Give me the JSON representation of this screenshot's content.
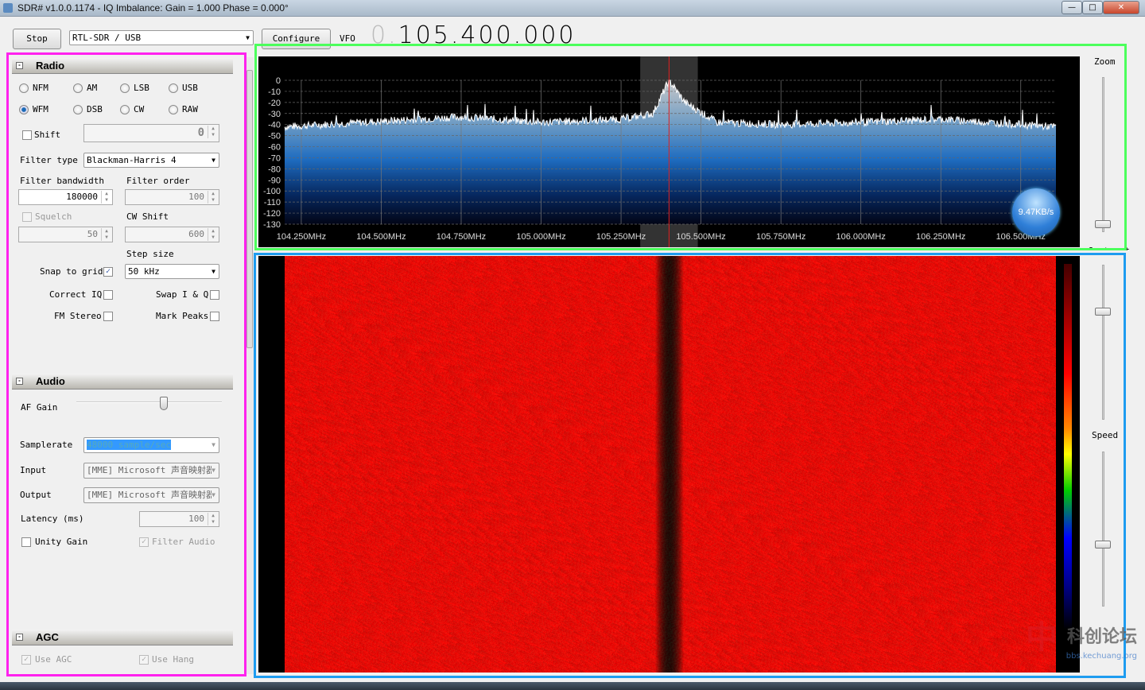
{
  "window": {
    "title": "SDR# v1.0.0.1174 - IQ Imbalance: Gain = 1.000 Phase = 0.000°",
    "minimize": "—",
    "maximize": "□",
    "close": "✕"
  },
  "toolbar": {
    "stop_label": "Stop",
    "source": "RTL-SDR / USB",
    "configure_label": "Configure",
    "vfo_label": "VFO",
    "vfo_dim": "0.",
    "vfo_value": "105.400.000"
  },
  "radio": {
    "header": "Radio",
    "modes": [
      {
        "label": "NFM",
        "selected": false
      },
      {
        "label": "AM",
        "selected": false
      },
      {
        "label": "LSB",
        "selected": false
      },
      {
        "label": "USB",
        "selected": false
      },
      {
        "label": "WFM",
        "selected": true
      },
      {
        "label": "DSB",
        "selected": false
      },
      {
        "label": "CW",
        "selected": false
      },
      {
        "label": "RAW",
        "selected": false
      }
    ],
    "shift_label": "Shift",
    "shift_value": "0",
    "filter_type_label": "Filter type",
    "filter_type": "Blackman-Harris 4",
    "filter_bandwidth_label": "Filter bandwidth",
    "filter_bandwidth": "180000",
    "filter_order_label": "Filter order",
    "filter_order": "100",
    "squelch_label": "Squelch",
    "squelch_value": "50",
    "cw_shift_label": "CW Shift",
    "cw_shift": "600",
    "step_size_label": "Step size",
    "step_size": "50 kHz",
    "snap_label": "Snap to grid",
    "snap_checked": true,
    "correct_iq_label": "Correct IQ",
    "swap_iq_label": "Swap I & Q",
    "fm_stereo_label": "FM Stereo",
    "mark_peaks_label": "Mark Peaks"
  },
  "audio": {
    "header": "Audio",
    "af_gain_label": "AF Gain",
    "af_gain_percent": 60,
    "samplerate_label": "Samplerate",
    "samplerate": "48000 sample/sec",
    "input_label": "Input",
    "input": "[MME] Microsoft 声音映射器",
    "output_label": "Output",
    "output": "[MME] Microsoft 声音映射器",
    "latency_label": "Latency (ms)",
    "latency": "100",
    "unity_gain_label": "Unity Gain",
    "filter_audio_label": "Filter Audio"
  },
  "agc": {
    "header": "AGC",
    "use_agc_label": "Use AGC",
    "use_hang_label": "Use Hang"
  },
  "spectrum": {
    "y_ticks": [
      "0",
      "-10",
      "-20",
      "-30",
      "-40",
      "-50",
      "-60",
      "-70",
      "-80",
      "-90",
      "-100",
      "-110",
      "-120",
      "-130"
    ],
    "x_ticks": [
      "104.250MHz",
      "104.500MHz",
      "104.750MHz",
      "105.000MHz",
      "105.250MHz",
      "105.500MHz",
      "105.750MHz",
      "106.000MHz",
      "106.250MHz",
      "106.500MHz"
    ],
    "center_mhz": 105.4,
    "filter_bandwidth_hz": 180000,
    "noise_floor_db": -40,
    "peak_db": 0,
    "rate_badge": "9.47KB/s"
  },
  "chart_data": {
    "type": "area",
    "x_range_mhz": [
      104.2,
      106.6
    ],
    "y_range_db": [
      -130,
      0
    ],
    "x": [
      104.2,
      104.5,
      104.75,
      105.0,
      105.25,
      105.35,
      105.4,
      105.45,
      105.55,
      105.75,
      106.0,
      106.25,
      106.5,
      106.6
    ],
    "values": [
      -42,
      -37,
      -33,
      -38,
      -35,
      -30,
      0,
      -20,
      -38,
      -40,
      -38,
      -35,
      -40,
      -42
    ]
  },
  "side": {
    "zoom_label": "Zoom",
    "contrast_label": "Contrast",
    "speed_label": "Speed",
    "zoom_percent": 5,
    "contrast_percent": 70,
    "speed_percent": 40
  },
  "watermark": "科创论坛 bbs.kechuang.org"
}
